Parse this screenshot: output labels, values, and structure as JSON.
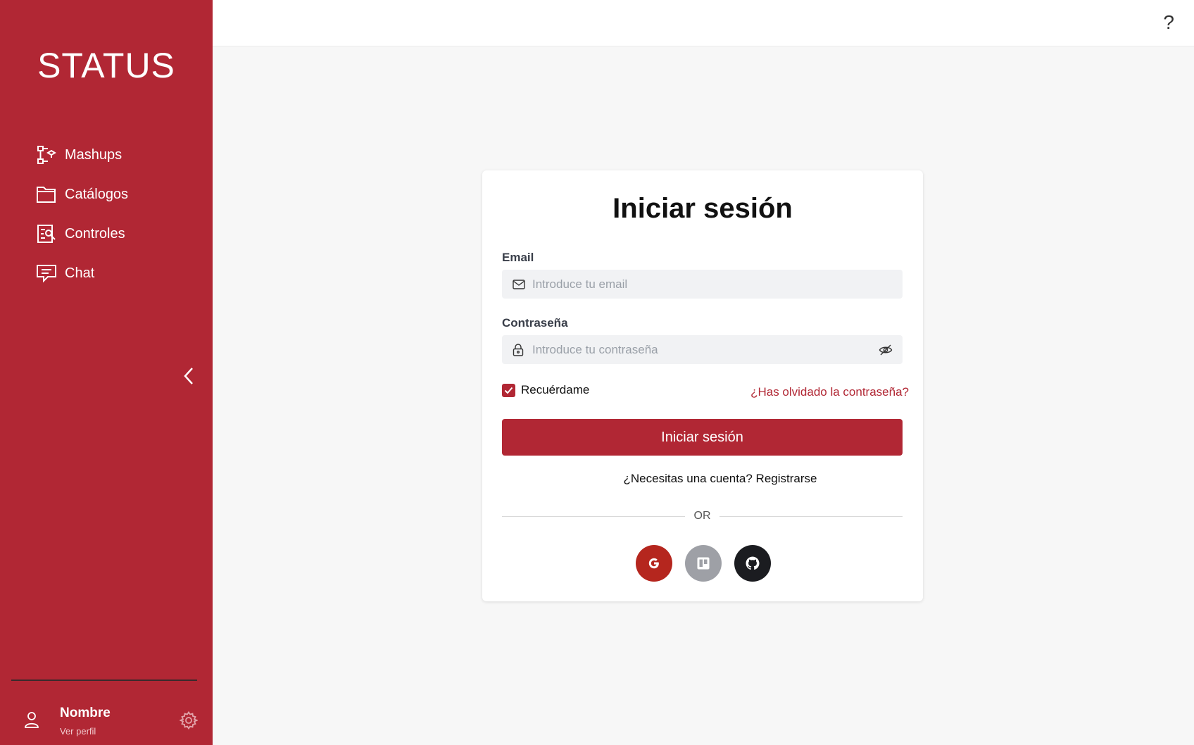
{
  "sidebar": {
    "brand": "STATUS",
    "items": [
      {
        "label": "Mashups",
        "icon": "mashups-icon"
      },
      {
        "label": "Catálogos",
        "icon": "folder-icon"
      },
      {
        "label": "Controles",
        "icon": "controls-icon"
      },
      {
        "label": "Chat",
        "icon": "chat-icon"
      }
    ],
    "user": {
      "name": "Nombre",
      "profile_link": "Ver perfil"
    }
  },
  "topbar": {
    "help": "?"
  },
  "login": {
    "title": "Iniciar sesión",
    "email_label": "Email",
    "email_placeholder": "Introduce tu email",
    "password_label": "Contraseña",
    "password_placeholder": "Introduce tu contraseña",
    "remember_label": "Recuérdame",
    "remember_checked": true,
    "forgot_link": "¿Has olvidado la contraseña?",
    "submit_label": "Iniciar sesión",
    "register_text": "¿Necesitas una cuenta? Registrarse",
    "divider": "OR",
    "social": [
      {
        "name": "google",
        "icon": "google-icon",
        "color": "#b5261e"
      },
      {
        "name": "trello",
        "icon": "trello-icon",
        "color": "#9ea0a6"
      },
      {
        "name": "github",
        "icon": "github-icon",
        "color": "#1b1c20"
      }
    ]
  },
  "colors": {
    "brand": "#b12734",
    "background": "#f7f7f7"
  }
}
